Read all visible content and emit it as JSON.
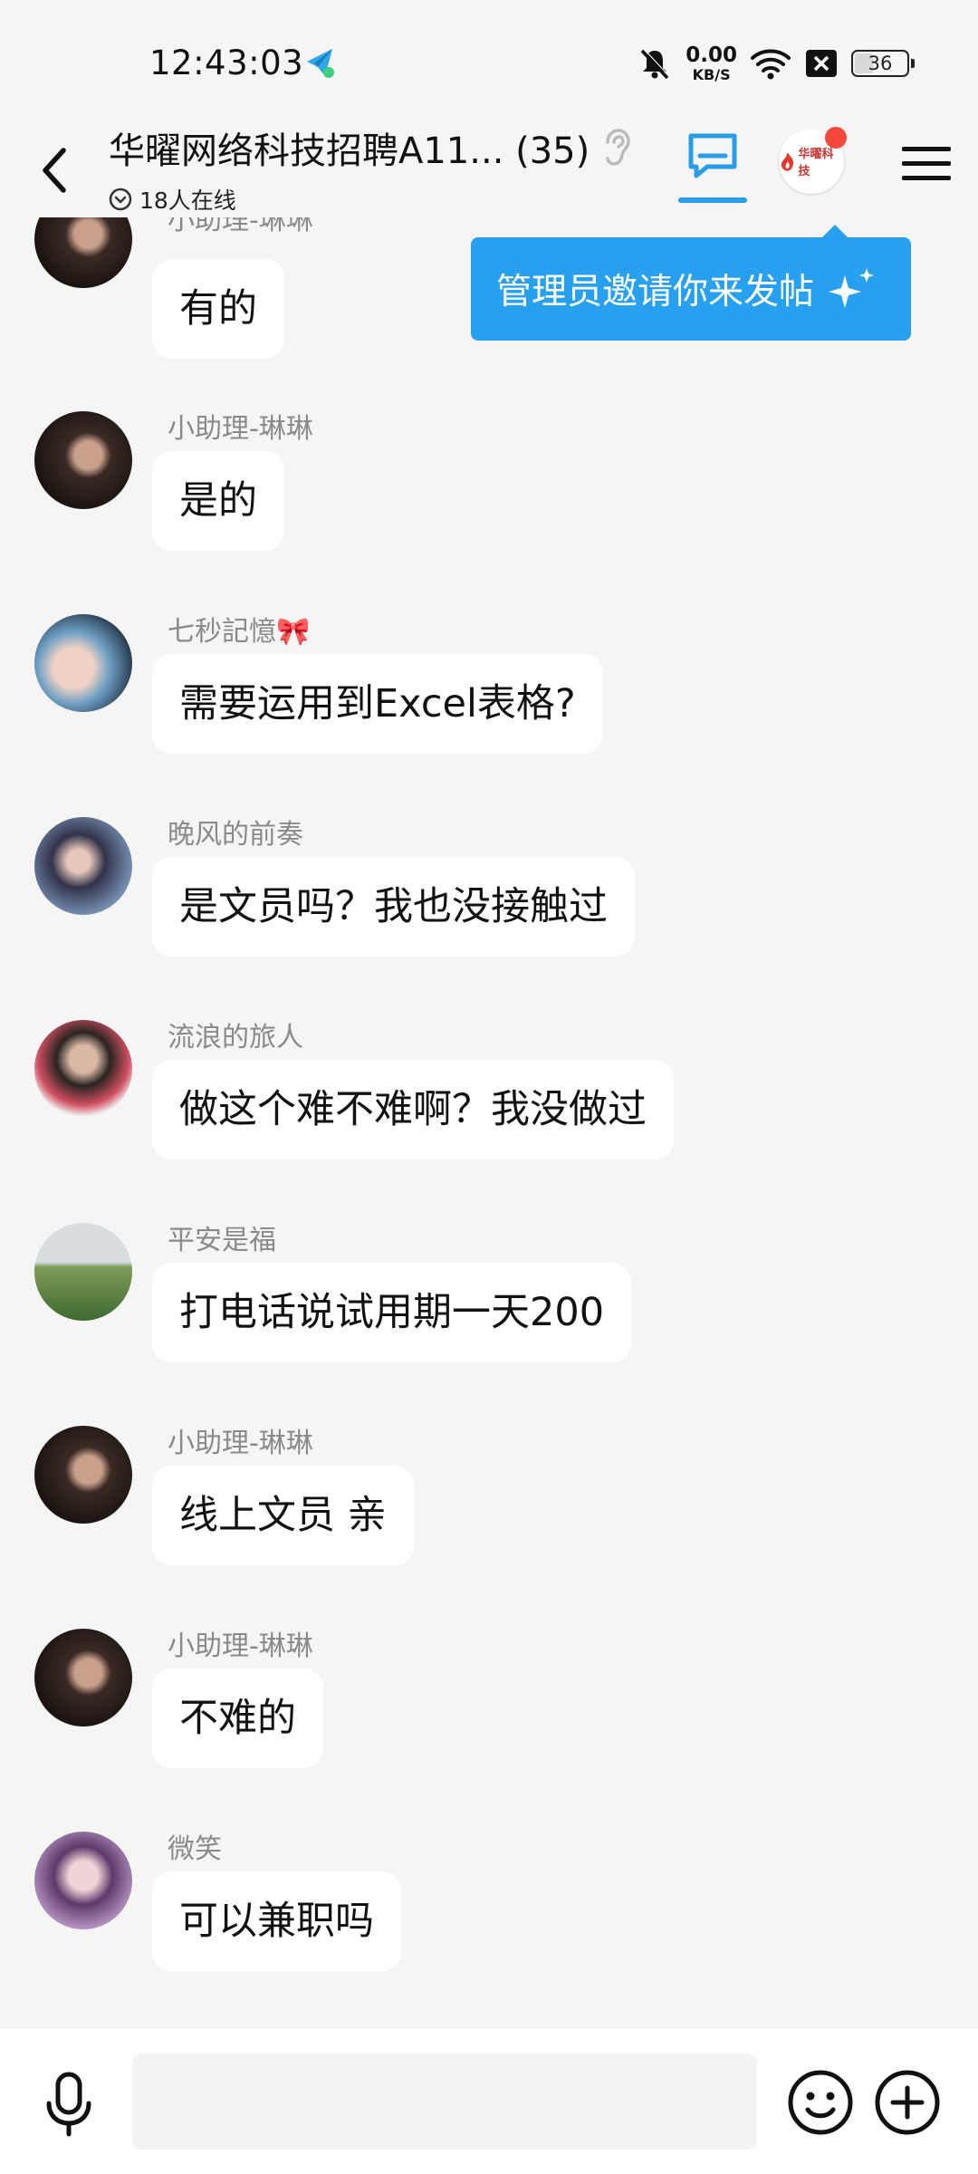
{
  "status_bar": {
    "time": "12:43:03",
    "net_speed_value": "0.00",
    "net_speed_unit": "KB/S",
    "battery": "36",
    "battery_level": 0.36
  },
  "header": {
    "title": "华曜网络科技招聘A11... (35)",
    "online": "18人在线",
    "group_avatar_text": "华曜科技",
    "active_tab_color": "#2a9de6",
    "badge_color": "#f3483b"
  },
  "tooltip": {
    "text": "管理员邀请你来发帖",
    "color": "#28a0f0"
  },
  "messages": [
    {
      "sender": "小助理-琳琳",
      "text": "有的",
      "avatar": "linlin"
    },
    {
      "sender": "小助理-琳琳",
      "text": "是的",
      "avatar": "linlin"
    },
    {
      "sender": "七秒記憶🎀",
      "text": "需要运用到Excel表格?",
      "avatar": "hand"
    },
    {
      "sender": "晚风的前奏",
      "text": "是文员吗？我也没接触过",
      "avatar": "wanfeng"
    },
    {
      "sender": "流浪的旅人",
      "text": "做这个难不难啊？我没做过",
      "avatar": "liulang"
    },
    {
      "sender": "平安是福",
      "text": "打电话说试用期一天200",
      "avatar": "pingan"
    },
    {
      "sender": "小助理-琳琳",
      "text": "线上文员 亲",
      "avatar": "linlin"
    },
    {
      "sender": "小助理-琳琳",
      "text": "不难的",
      "avatar": "linlin"
    },
    {
      "sender": "微笑",
      "text": "可以兼职吗",
      "avatar": "weixiao"
    }
  ],
  "input": {
    "placeholder": ""
  }
}
